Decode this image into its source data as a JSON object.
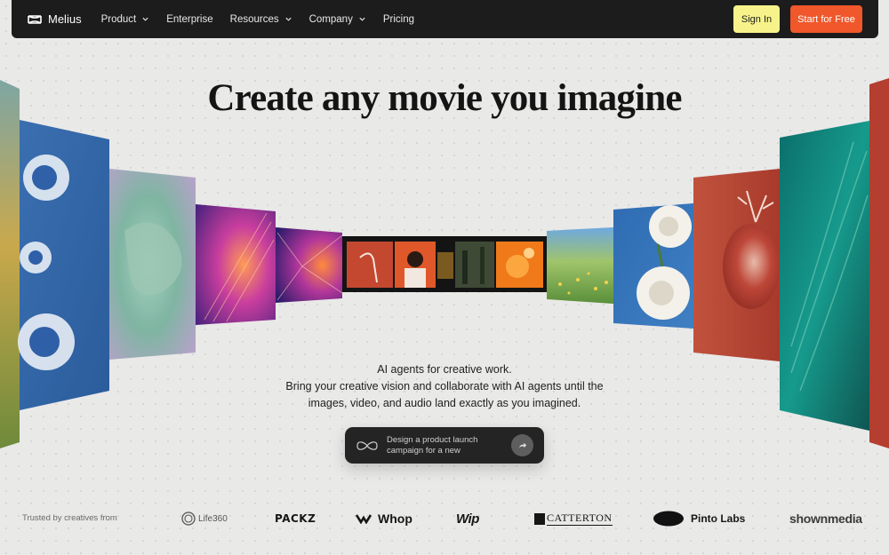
{
  "nav": {
    "logo_text": "Melius",
    "items": [
      {
        "label": "Product",
        "has_dropdown": true
      },
      {
        "label": "Enterprise",
        "has_dropdown": false
      },
      {
        "label": "Resources",
        "has_dropdown": true
      },
      {
        "label": "Company",
        "has_dropdown": true
      },
      {
        "label": "Pricing",
        "has_dropdown": false
      }
    ],
    "signin_label": "Sign In",
    "start_label": "Start for Free"
  },
  "hero": {
    "title": "Create any movie you imagine",
    "subtitle_lines": [
      "AI agents for creative work.",
      "Bring your creative vision and collaborate with AI agents until the",
      "images, video, and audio land exactly as you imagined."
    ]
  },
  "prompt": {
    "text_line1": "Design a product launch",
    "text_line2": "campaign for a new"
  },
  "trusted": {
    "label": "Trusted by creatives from",
    "brands": [
      "Life360",
      "PACKZ",
      "Whop",
      "Wip",
      "CATTERTON",
      "Pinto Labs",
      "shownmedia"
    ]
  },
  "colors": {
    "nav_bg": "#1c1c1c",
    "signin_bg": "#f7f38a",
    "start_bg": "#f0572a",
    "page_bg": "#e9e9e8"
  }
}
